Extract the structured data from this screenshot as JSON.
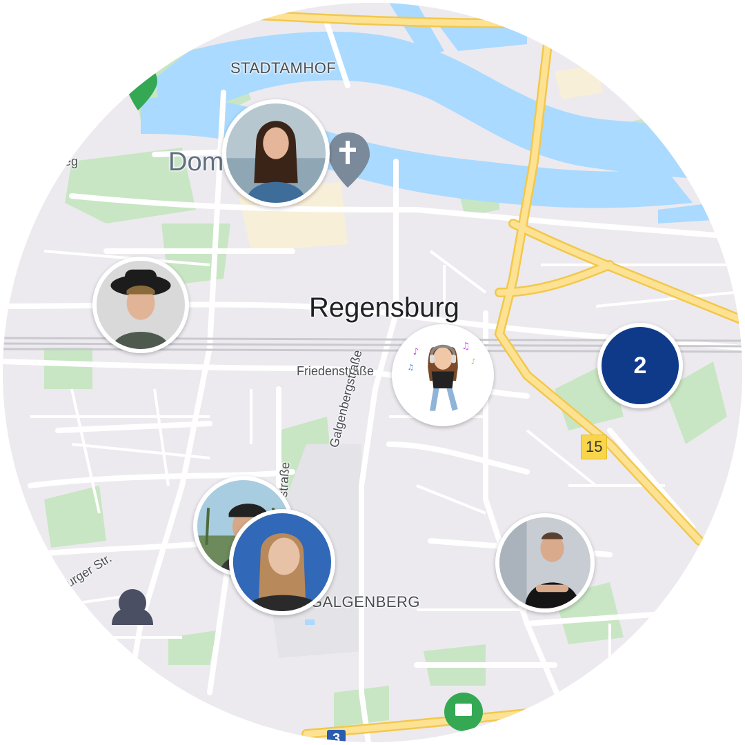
{
  "map": {
    "labels": {
      "city": "Regensburg",
      "district_stadtamhof": "STADTAMHOF",
      "district_galgenberg": "GALGENBERG",
      "poi_dom": "Dom",
      "street_friedenstrasse": "Friedenstraße",
      "street_galgenbergstrasse": "Galgenbergstraße",
      "street_partial_strasse": "straße",
      "street_partial_weg": "weg",
      "street_partial_burger": "urger Str."
    },
    "road_shields": {
      "shield_15": "15",
      "shield_3": "3"
    },
    "cluster": {
      "count": "2",
      "color": "#0f3a8a"
    },
    "colors": {
      "water": "#aadaff",
      "park": "#c8e6c3",
      "highway": "#fde293",
      "land": "#eceaef"
    }
  }
}
